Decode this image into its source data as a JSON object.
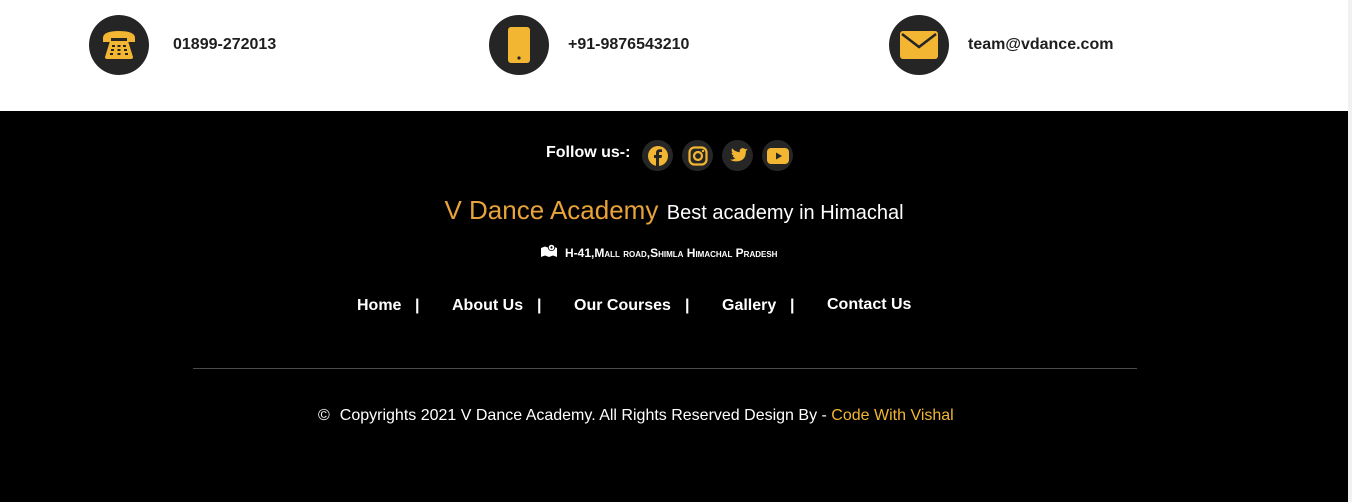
{
  "contacts": [
    {
      "icon": "telephone-icon",
      "text": "01899-272013"
    },
    {
      "icon": "mobile-phone-icon",
      "text": "+91-9876543210"
    },
    {
      "icon": "envelope-icon",
      "text": "team@vdance.com"
    }
  ],
  "social": {
    "label": "Follow us-:",
    "links": [
      "facebook-icon",
      "instagram-icon",
      "twitter-icon",
      "youtube-icon"
    ]
  },
  "brand": {
    "name": "V Dance Academy",
    "tagline": "Best academy in Himachal"
  },
  "address": {
    "icon": "map-icon",
    "text": "H-41,Mall road,Shimla Himachal Pradesh"
  },
  "nav": {
    "items": [
      "Home",
      "About Us",
      "Our Courses",
      "Gallery",
      "Contact Us"
    ],
    "separator": "|"
  },
  "copyright": {
    "symbol": "©",
    "text": "Copyrights 2021 V Dance Academy. All Rights Reserved Design By - ",
    "author": "Code With Vishal"
  },
  "colors": {
    "accent": "#f2b632",
    "brand": "#e8a33b",
    "footer_bg": "#000000",
    "icon_bg": "#252525"
  }
}
